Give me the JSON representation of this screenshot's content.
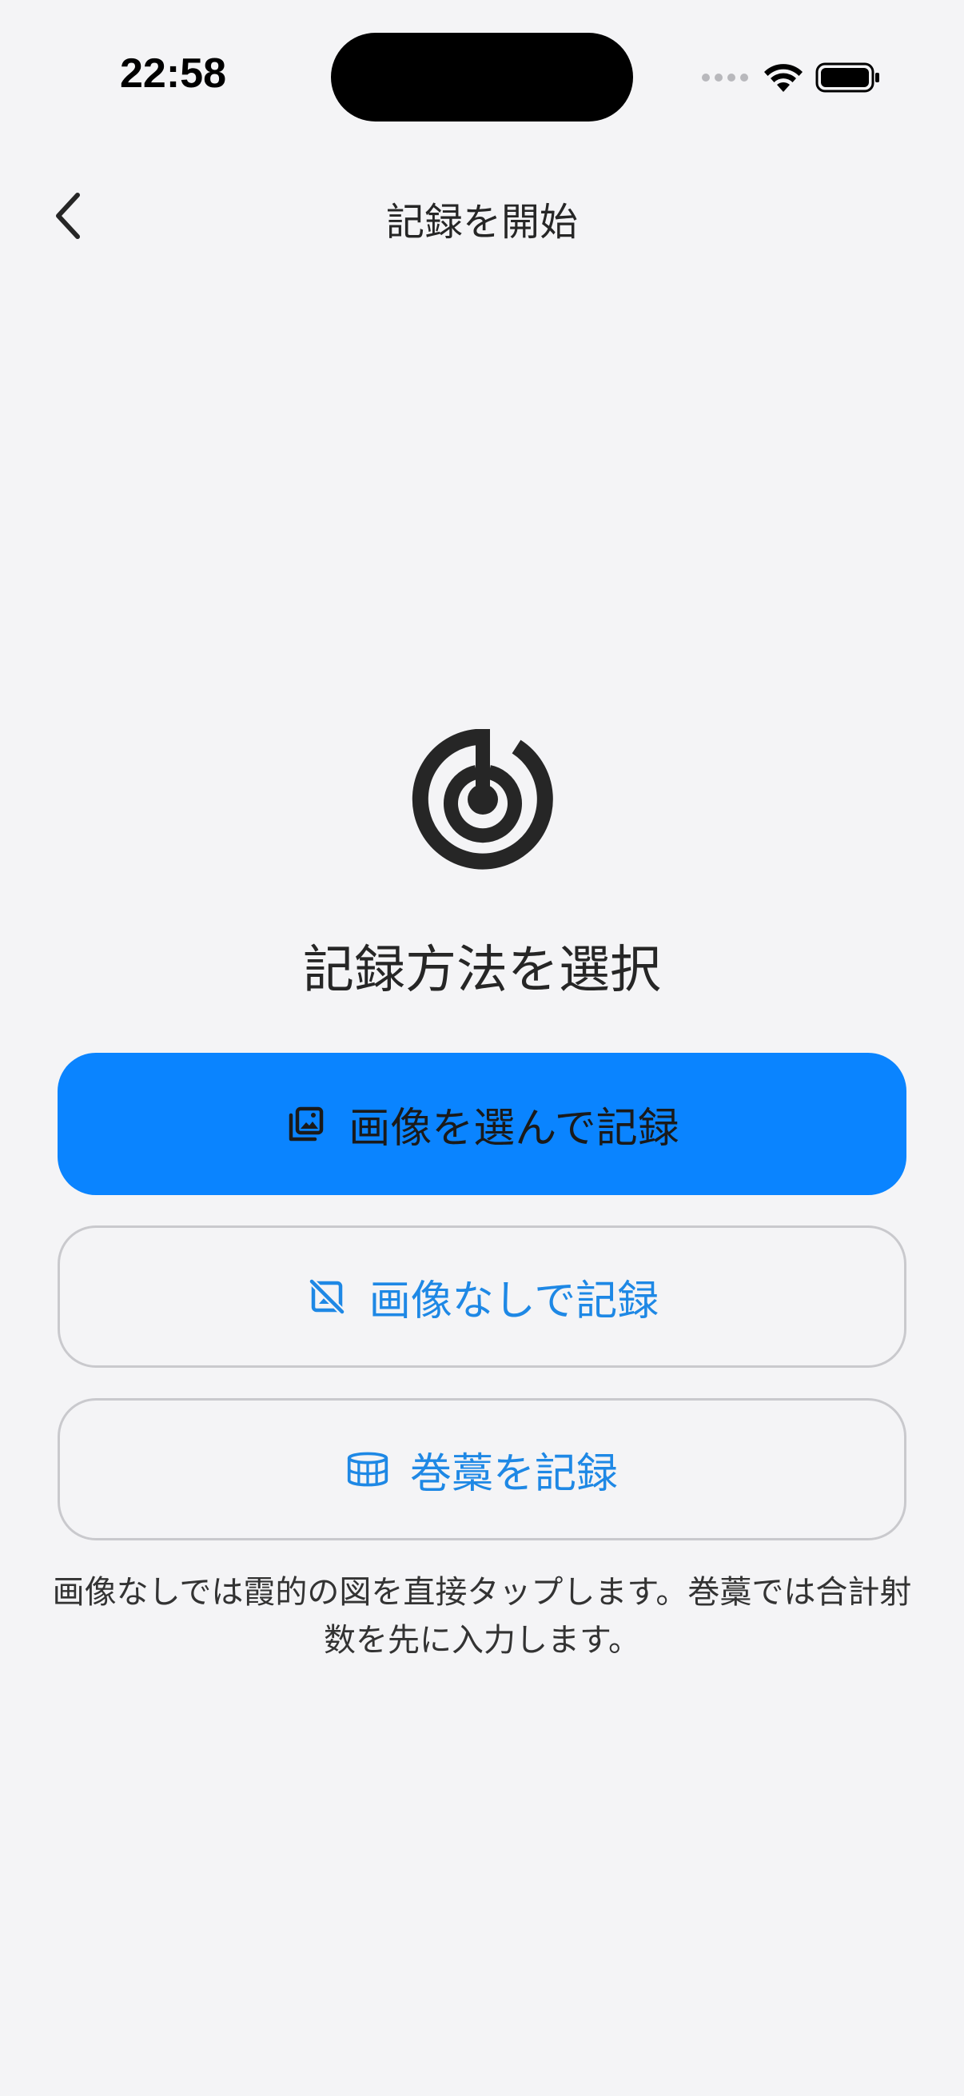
{
  "status_bar": {
    "time": "22:58"
  },
  "nav": {
    "title": "記録を開始"
  },
  "main": {
    "heading": "記録方法を選択",
    "buttons": {
      "with_image": "画像を選んで記録",
      "without_image": "画像なしで記録",
      "makiwara": "巻藁を記録"
    },
    "note": "画像なしでは霞的の図を直接タップします。巻藁では合計射数を先に入力します。"
  },
  "colors": {
    "background": "#f4f4f6",
    "accent": "#0a84ff",
    "link_text": "#1e88e5",
    "outline": "#c9c9cd"
  },
  "icons": {
    "back": "chevron-left-icon",
    "logo": "target-icon",
    "with_image": "photo-stack-icon",
    "without_image": "photo-slash-icon",
    "makiwara": "makiwara-icon"
  }
}
